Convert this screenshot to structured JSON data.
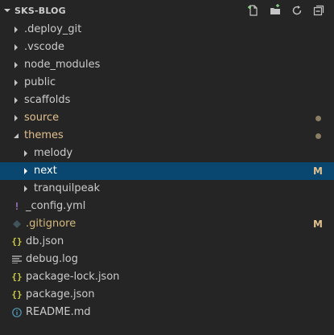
{
  "header": {
    "title": "SKS-BLOG",
    "actions": [
      "new-file-icon",
      "new-folder-icon",
      "refresh-icon",
      "collapse-all-icon"
    ]
  },
  "tree": [
    {
      "label": ".deploy_git",
      "type": "folder",
      "expanded": false,
      "indent": 0,
      "status": ""
    },
    {
      "label": ".vscode",
      "type": "folder",
      "expanded": false,
      "indent": 0,
      "status": ""
    },
    {
      "label": "node_modules",
      "type": "folder",
      "expanded": false,
      "indent": 0,
      "status": ""
    },
    {
      "label": "public",
      "type": "folder",
      "expanded": false,
      "indent": 0,
      "status": ""
    },
    {
      "label": "scaffolds",
      "type": "folder",
      "expanded": false,
      "indent": 0,
      "status": ""
    },
    {
      "label": "source",
      "type": "folder",
      "expanded": false,
      "indent": 0,
      "status": "dot"
    },
    {
      "label": "themes",
      "type": "folder",
      "expanded": true,
      "indent": 0,
      "status": "dot"
    },
    {
      "label": "melody",
      "type": "folder",
      "expanded": false,
      "indent": 1,
      "status": ""
    },
    {
      "label": "next",
      "type": "folder",
      "expanded": false,
      "indent": 1,
      "status": "M",
      "selected": true
    },
    {
      "label": "tranquilpeak",
      "type": "folder",
      "expanded": false,
      "indent": 1,
      "status": ""
    },
    {
      "label": "_config.yml",
      "type": "file",
      "icon": "!",
      "indent": 0,
      "status": ""
    },
    {
      "label": ".gitignore",
      "type": "file",
      "icon": "diamond",
      "indent": 0,
      "status": "M"
    },
    {
      "label": "db.json",
      "type": "file",
      "icon": "{}",
      "indent": 0,
      "status": ""
    },
    {
      "label": "debug.log",
      "type": "file",
      "icon": "lines",
      "indent": 0,
      "status": ""
    },
    {
      "label": "package-lock.json",
      "type": "file",
      "icon": "{}",
      "indent": 0,
      "status": ""
    },
    {
      "label": "package.json",
      "type": "file",
      "icon": "{}",
      "indent": 0,
      "status": ""
    },
    {
      "label": "README.md",
      "type": "file",
      "icon": "info",
      "indent": 0,
      "status": ""
    }
  ],
  "colors": {
    "background": "#252526",
    "selected": "#094771",
    "modified": "#e2c08d",
    "json": "#cbcb41",
    "yaml": "#a074c4",
    "info": "#519aba"
  }
}
